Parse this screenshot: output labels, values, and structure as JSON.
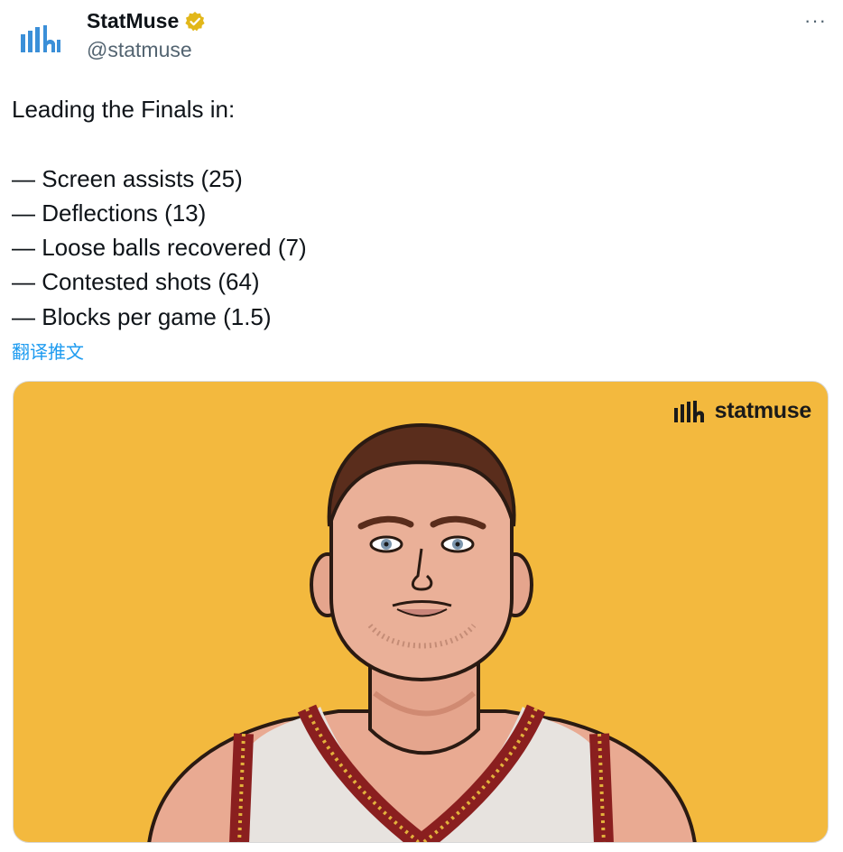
{
  "account": {
    "display_name": "StatMuse",
    "handle": "@statmuse",
    "verified": true,
    "avatar_icon": "statmuse-logo-icon",
    "brand_color": "#3b8fd8"
  },
  "menu": {
    "more_label": "···"
  },
  "tweet": {
    "intro": "Leading the Finals in:",
    "items": [
      "— Screen assists (25)",
      "— Deflections (13)",
      "— Loose balls recovered (7)",
      "— Contested shots (64)",
      "— Blocks per game (1.5)"
    ],
    "translate_label": "翻译推文"
  },
  "media": {
    "background_color": "#f3b93e",
    "brand_text": "statmuse",
    "brand_icon": "statmuse-bars-icon",
    "illustration": "player-portrait-illustration"
  },
  "colors": {
    "link": "#1d9bf0",
    "verified_badge": "#e2b719"
  }
}
